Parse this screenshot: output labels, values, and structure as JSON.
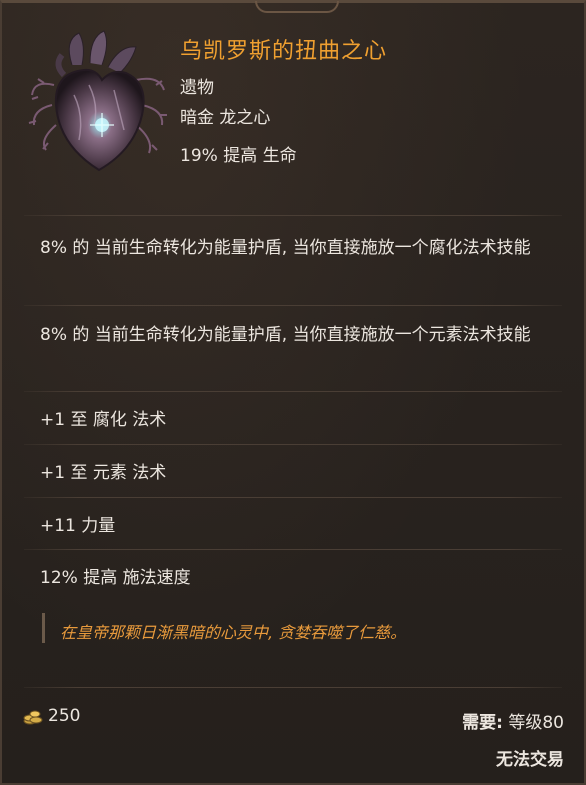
{
  "item": {
    "name": "乌凯罗斯的扭曲之心",
    "type": "遗物",
    "subtype": "暗金 龙之心",
    "implicit": "19% 提高 生命",
    "name_color": "#f0a030"
  },
  "affixes": [
    "8% 的 当前生命转化为能量护盾, 当你直接施放一个腐化法术技能",
    "8% 的 当前生命转化为能量护盾, 当你直接施放一个元素法术技能",
    "+1 至 腐化 法术",
    "+1 至 元素 法术",
    "+11 力量",
    "12% 提高 施法速度"
  ],
  "lore": "在皇帝那颗日渐黑暗的心灵中, 贪婪吞噬了仁慈。",
  "footer": {
    "gold_icon": "gold-coins-icon",
    "gold_value": "250",
    "requirement_label": "需要:",
    "requirement_value": "等级80",
    "trade_status": "无法交易"
  }
}
